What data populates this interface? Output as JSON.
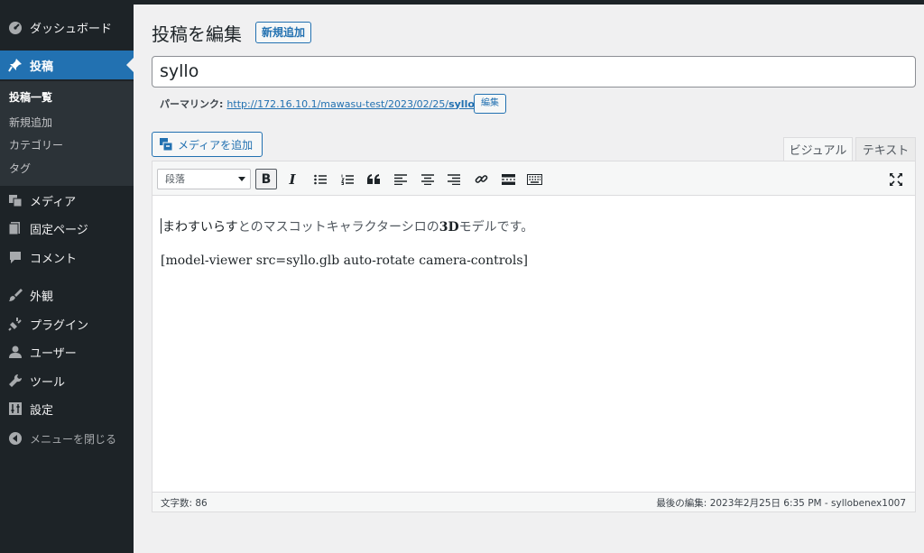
{
  "sidebar": {
    "dashboard": "ダッシュボード",
    "posts": "投稿",
    "posts_sub": [
      "投稿一覧",
      "新規追加",
      "カテゴリー",
      "タグ"
    ],
    "media": "メディア",
    "pages": "固定ページ",
    "comments": "コメント",
    "appearance": "外観",
    "plugins": "プラグイン",
    "users": "ユーザー",
    "tools": "ツール",
    "settings": "設定",
    "collapse": "メニューを閉じる"
  },
  "page": {
    "title": "投稿を編集",
    "add_new": "新規追加"
  },
  "post": {
    "title_value": "syllo",
    "permalink_label": "パーマリンク:",
    "permalink_base": "http://172.16.10.1/mawasu-test/2023/02/25/",
    "permalink_slug": "syllo",
    "permalink_trailing": "/",
    "permalink_edit": "編集"
  },
  "editor": {
    "add_media": "メディアを追加",
    "tab_visual": "ビジュアル",
    "tab_text": "テキスト",
    "format_value": "段落",
    "para1_bold": "まわすいらす",
    "para1_rest": "とのマスコットキャラクターシロの",
    "para1_bold2": "3D",
    "para1_end": "モデルです。",
    "para2": "[model-viewer src=syllo.glb auto-rotate camera-controls]",
    "word_count": "文字数: 86",
    "last_edit": "最後の編集: 2023年2月25日 6:35 PM - syllobenex1007"
  },
  "colors": {
    "sidebar_bg": "#1d2327",
    "active_blue": "#2271b1",
    "page_bg": "#f0f0f1"
  }
}
